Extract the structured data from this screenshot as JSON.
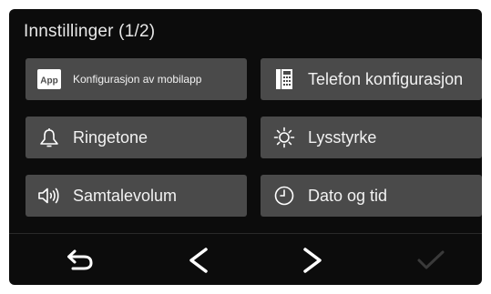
{
  "screen": {
    "title": "Innstillinger (1/2)"
  },
  "buttons": [
    {
      "label": "Konfigurasjon av mobilapp",
      "icon": "app-icon",
      "icon_text": "App"
    },
    {
      "label": "Telefon konfigurasjon",
      "icon": "phone-icon"
    },
    {
      "label": "Ringetone",
      "icon": "bell-icon"
    },
    {
      "label": "Lysstyrke",
      "icon": "brightness-icon"
    },
    {
      "label": "Samtalevolum",
      "icon": "speaker-icon"
    },
    {
      "label": "Dato og tid",
      "icon": "clock-icon"
    }
  ],
  "nav": {
    "back": "back-arrow-icon",
    "previous": "chevron-left-icon",
    "next": "chevron-right-icon",
    "confirm": "checkmark-icon",
    "confirm_enabled": false
  },
  "colors": {
    "background": "#0c0c0c",
    "button": "#4a4a4a",
    "text": "#f2f2f2",
    "disabled": "#3a3a3a"
  }
}
